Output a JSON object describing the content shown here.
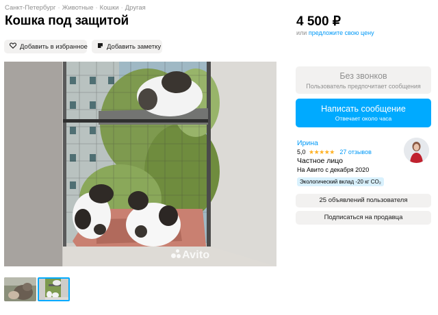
{
  "breadcrumbs": [
    "Санкт-Петербург",
    "Животные",
    "Кошки",
    "Другая"
  ],
  "listing": {
    "title": "Кошка под защитой",
    "add_favorite_label": "Добавить в избранное",
    "add_note_label": "Добавить заметку",
    "watermark": "Avito"
  },
  "price": {
    "amount": "4 500 ₽",
    "prefix": "или",
    "offer_link": "предложите свою цену"
  },
  "contact": {
    "no_calls_title": "Без звонков",
    "no_calls_subtitle": "Пользователь предпочитает сообщения",
    "message_button": "Написать сообщение",
    "message_subtitle": "Отвечает около часа"
  },
  "seller": {
    "name": "Ирина",
    "rating": "5,0",
    "stars": "★★★★★",
    "reviews": "27 отзывов",
    "type": "Частное лицо",
    "since": "На Авито с декабря 2020",
    "eco_badge": "Экологический вклад -20 кг CO₂",
    "ads_button": "25 объявлений пользователя",
    "subscribe_button": "Подписаться на продавца"
  },
  "colors": {
    "accent": "#00aaff",
    "link": "#0099f7",
    "button_gray": "#f2f1f0",
    "star": "#ffb021"
  },
  "icons": {
    "favorite": "heart-icon",
    "note": "note-icon"
  },
  "gallery": {
    "thumbnails": 2,
    "selected": 2
  }
}
